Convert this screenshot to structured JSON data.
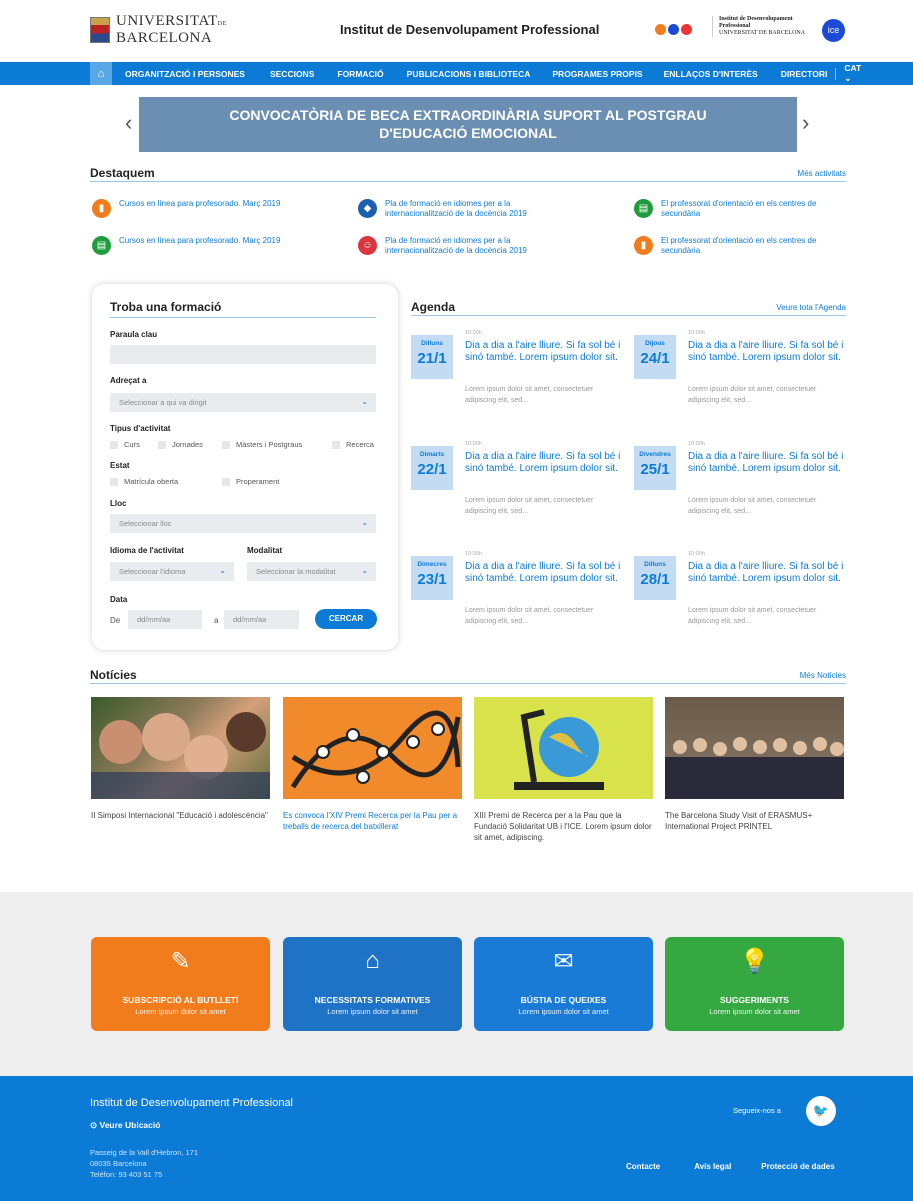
{
  "header": {
    "ub_logo": "UNIVERSITAT DE BARCELONA",
    "ub_line1": "UNIVERSITAT",
    "ub_line1_suffix": "DE",
    "ub_line2": "BARCELONA",
    "site_title": "Institut de Desenvolupament Professional",
    "idp_logo_line1": "Institut de Desenvolupament",
    "idp_logo_line2": "Professional",
    "idp_logo_line3": "UNIVERSITAT DE BARCELONA",
    "ice_badge": "ice"
  },
  "nav": {
    "home_icon": "home-icon",
    "items": [
      "ORGANITZACIÓ I PERSONES",
      "SECCIONS",
      "FORMACIÓ",
      "PUBLICACIONS I BIBLIOTECA",
      "PROGRAMES PROPIS",
      "ENLLAÇOS D'INTERÈS",
      "DIRECTORI",
      "CAT"
    ]
  },
  "banner": {
    "line1": "CONVOCATÒRIA DE BECA EXTRAORDINÀRIA SUPORT AL POSTGRAU",
    "line2": "D'EDUCACIÓ EMOCIONAL",
    "prev": "‹",
    "next": "›"
  },
  "destaquem": {
    "title": "Destaquem",
    "more": "Més activitats",
    "items": [
      {
        "text": "Cursos en línea para profesorado. Març 2019",
        "color": "#f07c1c",
        "icon": "book-icon"
      },
      {
        "text": "Pla de formació en idiomes per a la internacionalització de la docència 2019",
        "color": "#1c5fae",
        "icon": "graduation-icon"
      },
      {
        "text": "El professorat d'orientació en els centres de secundària",
        "color": "#1f9c3b",
        "icon": "document-icon"
      },
      {
        "text": "Cursos en línea para profesorado. Març 2019",
        "color": "#1f9c3b",
        "icon": "document-icon"
      },
      {
        "text": "Pla de formació en idiomes per a la internacionalització de la docència 2019",
        "color": "#d9363e",
        "icon": "people-icon"
      },
      {
        "text": "El professorat d'orientació en els centres de secundària",
        "color": "#f07c1c",
        "icon": "book-icon"
      }
    ]
  },
  "form": {
    "title": "Troba una formació",
    "keyword_label": "Paraula clau",
    "keyword_value": "",
    "audience_label": "Adreçat a",
    "audience_placeholder": "Seleccionar a qui va dirigit",
    "type_label": "Tipus d'activitat",
    "types": [
      "Curs",
      "Jornades",
      "Màsters i Postgraus",
      "Recerca"
    ],
    "status_label": "Estat",
    "statuses": [
      "Matrícula oberta",
      "Properament"
    ],
    "place_label": "Lloc",
    "place_placeholder": "Seleccionar lloc",
    "lang_label": "Idioma de l'activitat",
    "lang_placeholder": "Seleccionar l'idioma",
    "mode_label": "Modalitat",
    "mode_placeholder": "Seleccionar la modalitat",
    "date_label": "Data",
    "from_label": "De",
    "to_label": "a",
    "date_placeholder": "dd/mm/aa",
    "search_button": "CERCAR"
  },
  "agenda": {
    "title": "Agenda",
    "more": "Veure tota l'Agenda",
    "events": [
      {
        "day": "Dilluns",
        "date": "21/1",
        "time": "10:00h",
        "title": "Dia a dia a l'aire lliure. Si fa sol bé i sinó també. Lorem ipsum dolor sit.",
        "desc": "Lorem ipsum dolor sit amet, consectetuer adipiscing elit, sed..."
      },
      {
        "day": "Dijous",
        "date": "24/1",
        "time": "10:00h",
        "title": "Dia a dia a l'aire lliure. Si fa sol bé i sinó també. Lorem ipsum dolor sit.",
        "desc": "Lorem ipsum dolor sit amet, consectetuer adipiscing elit, sed..."
      },
      {
        "day": "Dimarts",
        "date": "22/1",
        "time": "10:00h",
        "title": "Dia a dia a l'aire lliure. Si fa sol bé i sinó també. Lorem ipsum dolor sit.",
        "desc": "Lorem ipsum dolor sit amet, consectetuer adipiscing elit, sed..."
      },
      {
        "day": "Divendres",
        "date": "25/1",
        "time": "10:00h",
        "title": "Dia a dia a l'aire lliure. Si fa sol bé i sinó també. Lorem ipsum dolor sit.",
        "desc": "Lorem ipsum dolor sit amet, consectetuer adipiscing elit, sed..."
      },
      {
        "day": "Dimecres",
        "date": "23/1",
        "time": "10:00h",
        "title": "Dia a dia a l'aire lliure. Si fa sol bé i sinó també. Lorem ipsum dolor sit.",
        "desc": "Lorem ipsum dolor sit amet, consectetuer adipiscing elit, sed..."
      },
      {
        "day": "Dilluns",
        "date": "28/1",
        "time": "10:00h",
        "title": "Dia a dia a l'aire lliure. Si fa sol bé i sinó també. Lorem ipsum dolor sit.",
        "desc": "Lorem ipsum dolor sit amet, consectetuer adipiscing elit, sed..."
      }
    ]
  },
  "news": {
    "title": "Notícies",
    "more": "Més Notícies",
    "items": [
      {
        "text": "II Simposi Internacional \"Educació i adolescència\"",
        "color": "#444"
      },
      {
        "text": "Es convoca l'XIV Premi Recerca per la Pau per a treballs de recerca del batxillerat",
        "color": "#0c7bd5"
      },
      {
        "text": "XIII Premi de Recerca per a la Pau que la Fundació Solidaritat UB i l'ICE. Lorem ipsum dolor sit amet, adipiscing.",
        "color": "#444"
      },
      {
        "text": "The Barcelona Study Visit of ERASMUS+ International Project PRINTEL",
        "color": "#444"
      }
    ]
  },
  "tiles": [
    {
      "title": "SUBSCRIPCIÓ AL BUTLLETÍ",
      "sub": "Lorem ipsum dolor sit amet",
      "color": "#f07c1c",
      "icon": "newsletter-icon"
    },
    {
      "title": "NECESSITATS FORMATIVES",
      "sub": "Lorem ipsum dolor sit amet",
      "color": "#1f73c7",
      "icon": "reader-icon"
    },
    {
      "title": "BÚSTIA DE QUEIXES",
      "sub": "Lorem ipsum dolor sit amet",
      "color": "#1a7bd6",
      "icon": "mailbox-icon"
    },
    {
      "title": "SUGGERIMENTS",
      "sub": "Lorem ipsum dolor sit amet",
      "color": "#35a842",
      "icon": "lightbulb-icon"
    }
  ],
  "footer": {
    "title": "Institut de Desenvolupament Professional",
    "location_link": "Veure Ubicació",
    "address1": "Passeig de la Vall d'Hebron, 171",
    "address2": "08035 Barcelona",
    "phone": "Teléfon: 93 403 51 75",
    "follow": "Segueix-nos a",
    "twitter_icon": "twitter-icon",
    "links": [
      "Contacte",
      "Avís legal",
      "Protecció de dades"
    ]
  }
}
